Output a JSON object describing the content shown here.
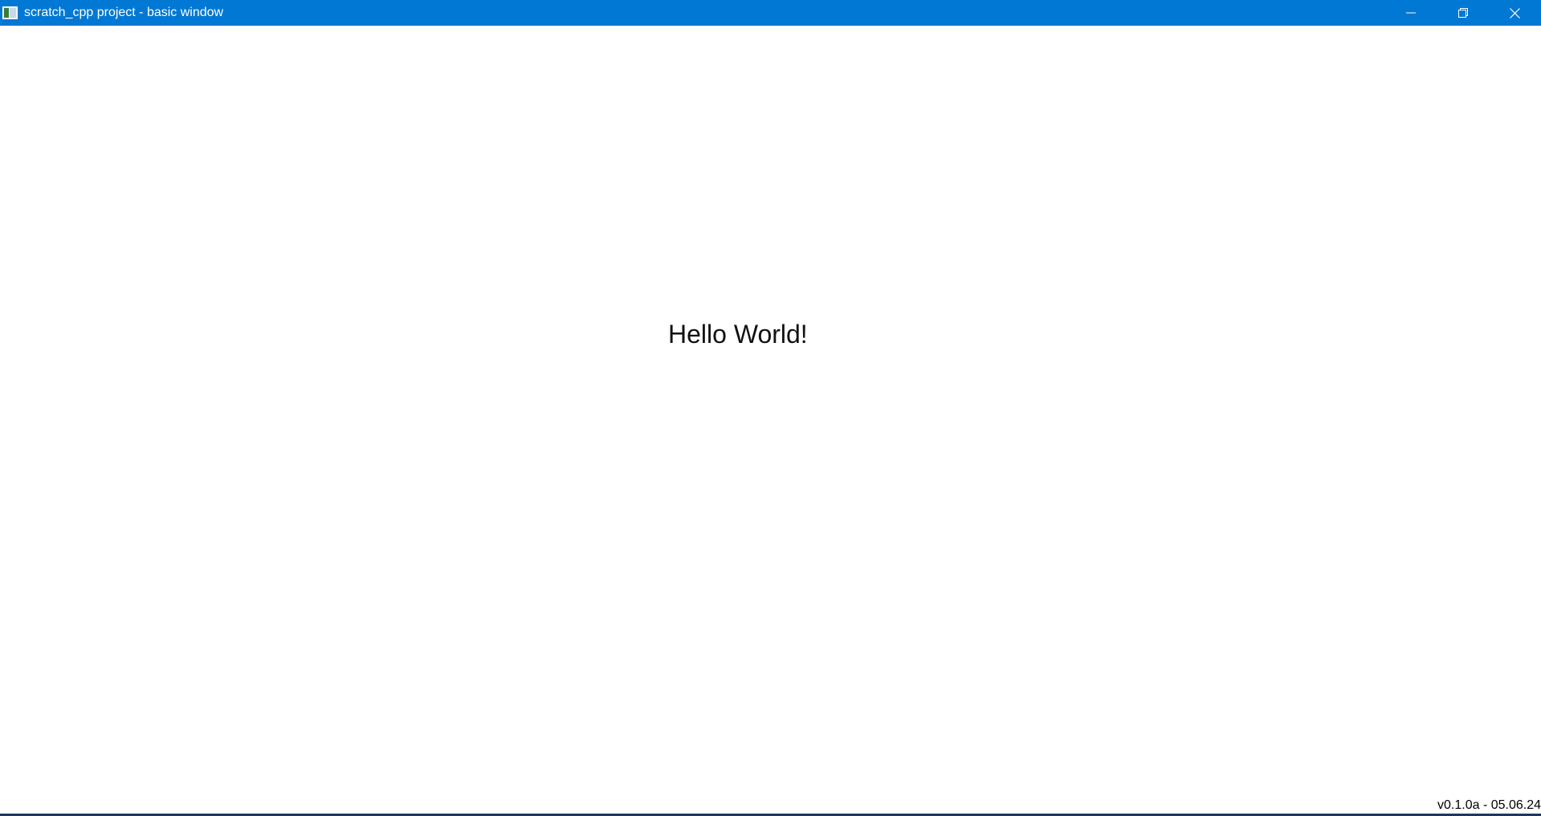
{
  "window": {
    "title": "scratch_cpp project - basic window",
    "accent_color": "#0078d4",
    "controls": {
      "minimize_icon": "minimize-icon",
      "restore_icon": "restore-icon",
      "close_icon": "close-icon"
    }
  },
  "content": {
    "greeting": "Hello World!",
    "version_label": "v0.1.0a - 05.06.24"
  }
}
